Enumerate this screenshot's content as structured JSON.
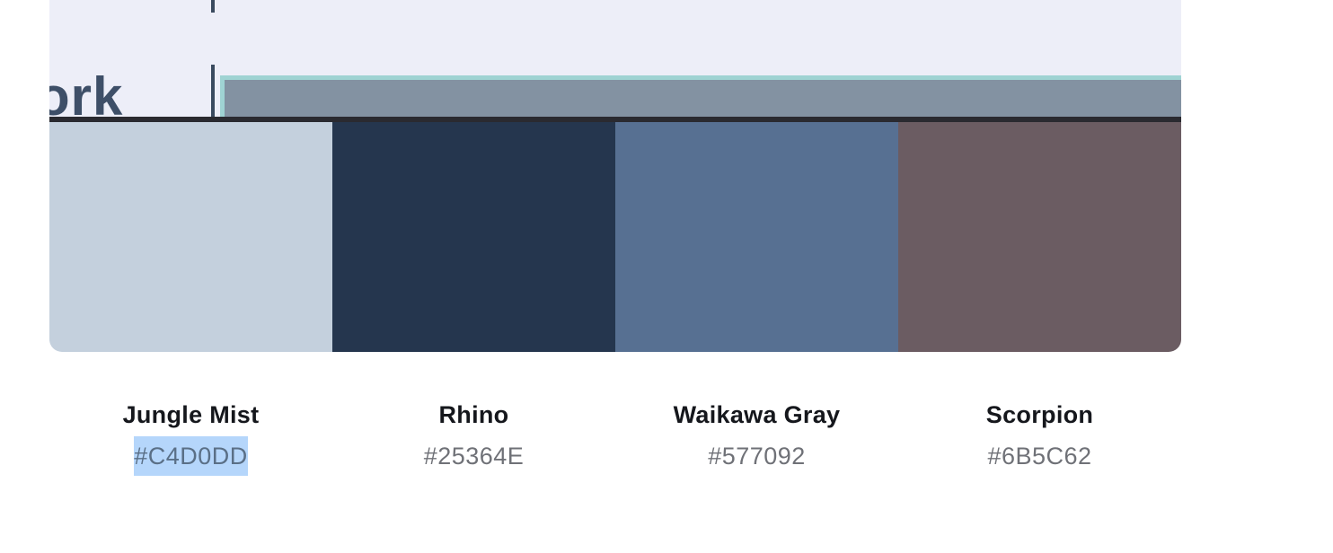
{
  "preview": {
    "word_fragment": "ork",
    "background": "#EDEEF8",
    "bar_color": "#8392A2",
    "bar_border": "#9FD3D3"
  },
  "palette": {
    "colors": [
      {
        "name": "Jungle Mist",
        "hex": "#C4D0DD",
        "selected": true
      },
      {
        "name": "Rhino",
        "hex": "#25364E",
        "selected": false
      },
      {
        "name": "Waikawa Gray",
        "hex": "#577092",
        "selected": false
      },
      {
        "name": "Scorpion",
        "hex": "#6B5C62",
        "selected": false
      }
    ]
  }
}
